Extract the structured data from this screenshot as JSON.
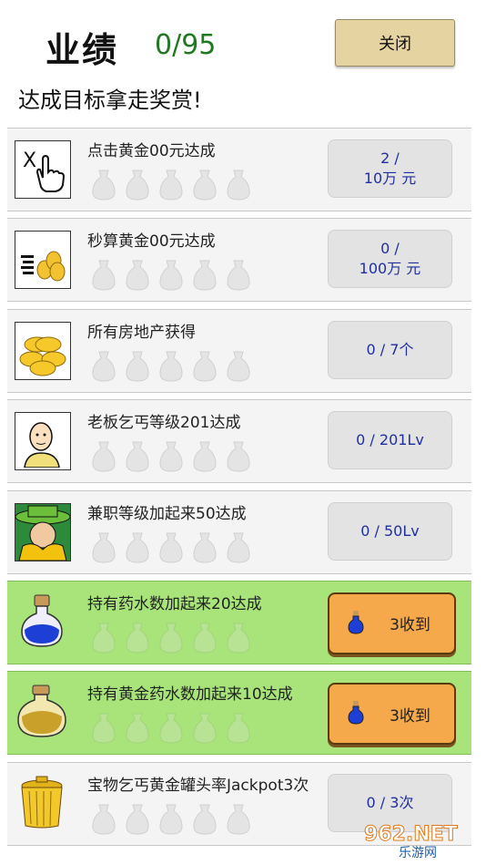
{
  "header": {
    "title": "业绩",
    "count": "0/95",
    "close_label": "关闭",
    "subtitle": "达成目标拿走奖赏!"
  },
  "achievements": [
    {
      "icon": "tap-finger-icon",
      "label": "点击黄金00元达成",
      "progress_line1": "2 /",
      "progress_line2": "10万 元",
      "status": "in-progress"
    },
    {
      "icon": "coins-stack-icon",
      "label": "秒算黄金00元达成",
      "progress_line1": "0 /",
      "progress_line2": "100万 元",
      "status": "in-progress"
    },
    {
      "icon": "gold-coins-icon",
      "label": "所有房地产获得",
      "progress_line1": "0 / 7个",
      "progress_line2": "",
      "status": "in-progress"
    },
    {
      "icon": "bald-man-icon",
      "label": "老板乞丐等级201达成",
      "progress_line1": "0 / 201Lv",
      "progress_line2": "",
      "status": "in-progress"
    },
    {
      "icon": "green-hat-man-icon",
      "label": "兼职等级加起来50达成",
      "progress_line1": "0 / 50Lv",
      "progress_line2": "",
      "status": "in-progress"
    },
    {
      "icon": "blue-potion-icon",
      "label": "持有药水数加起来20达成",
      "claim_label": "3收到",
      "status": "claimable"
    },
    {
      "icon": "gold-potion-icon",
      "label": "持有黄金药水数加起来10达成",
      "claim_label": "3收到",
      "status": "claimable"
    },
    {
      "icon": "gold-pot-icon",
      "label": "宝物乞丐黄金罐头率Jackpot3次",
      "progress_line1": "0 / 3次",
      "progress_line2": "",
      "status": "in-progress"
    }
  ],
  "watermark": {
    "text": "962.NET",
    "subtext": "乐游网"
  },
  "colors": {
    "claim_bg": "#f5a94a",
    "done_row": "#a8e47a",
    "progress_text": "#1f2fa0",
    "count_green": "#1f7a1f"
  }
}
